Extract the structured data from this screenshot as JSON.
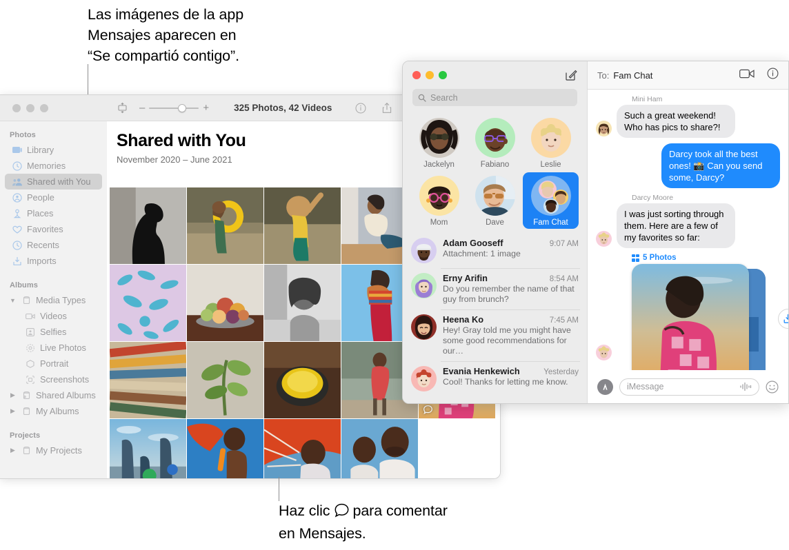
{
  "annotations": {
    "top": [
      "Las imágenes de la app",
      "Mensajes aparecen en",
      "“Se compartió contigo”."
    ],
    "bottom_before": "Haz clic",
    "bottom_after": "para comentar",
    "bottom_line2": "en Mensajes."
  },
  "photos": {
    "toolbar": {
      "import_icon": "import-icon",
      "zoom_minus": "–",
      "zoom_plus": "+",
      "count": "325 Photos, 42 Videos",
      "info_icon": "info-icon",
      "share_icon": "share-icon",
      "favorite_icon": "heart-icon",
      "rotate_icon": "rotate-icon"
    },
    "title": "Shared with You",
    "subtitle": "November 2020 – June 2021",
    "sidebar": {
      "sections": [
        {
          "header": "Photos",
          "items": [
            {
              "label": "Library",
              "icon": "library-icon",
              "selected": false
            },
            {
              "label": "Memories",
              "icon": "memories-icon",
              "selected": false
            },
            {
              "label": "Shared with You",
              "icon": "shared-with-you-icon",
              "selected": true
            },
            {
              "label": "People",
              "icon": "people-icon",
              "selected": false
            },
            {
              "label": "Places",
              "icon": "places-icon",
              "selected": false
            },
            {
              "label": "Favorites",
              "icon": "heart-icon",
              "selected": false
            },
            {
              "label": "Recents",
              "icon": "clock-icon",
              "selected": false
            },
            {
              "label": "Imports",
              "icon": "import-icon",
              "selected": false
            }
          ]
        },
        {
          "header": "Albums",
          "items": [
            {
              "label": "Media Types",
              "icon": "folder-icon",
              "disclosure": "open"
            },
            {
              "label": "Videos",
              "icon": "video-icon",
              "sub": true
            },
            {
              "label": "Selfies",
              "icon": "selfie-icon",
              "sub": true
            },
            {
              "label": "Live Photos",
              "icon": "live-photo-icon",
              "sub": true
            },
            {
              "label": "Portrait",
              "icon": "portrait-icon",
              "sub": true
            },
            {
              "label": "Screenshots",
              "icon": "screenshot-icon",
              "sub": true
            },
            {
              "label": "Shared Albums",
              "icon": "shared-folder-icon",
              "disclosure": "closed"
            },
            {
              "label": "My Albums",
              "icon": "folder-icon",
              "disclosure": "closed"
            }
          ]
        },
        {
          "header": "Projects",
          "items": [
            {
              "label": "My Projects",
              "icon": "folder-icon",
              "disclosure": "closed"
            }
          ]
        }
      ]
    },
    "grid": [
      {
        "name": "silhouette-bw-portrait",
        "comment": false
      },
      {
        "name": "child-yellow-float-river",
        "comment": false
      },
      {
        "name": "child-splashing-water",
        "comment": false
      },
      {
        "name": "man-seated-wall",
        "comment": false
      },
      {
        "name": "woman-doorway",
        "comment": false
      },
      {
        "name": "blue-floral-fabric",
        "comment": false
      },
      {
        "name": "fruit-bowl",
        "comment": false
      },
      {
        "name": "bw-portrait-curly-hair",
        "comment": false
      },
      {
        "name": "woman-red-pants-sky",
        "comment": false
      },
      {
        "name": "green-hillside",
        "comment": false
      },
      {
        "name": "colored-pencils",
        "comment": false
      },
      {
        "name": "green-plant-leaves",
        "comment": false
      },
      {
        "name": "yellow-bowl-fruit",
        "comment": false
      },
      {
        "name": "woman-walking-street",
        "comment": false
      },
      {
        "name": "field-landscape",
        "comment": false
      },
      {
        "name": "woman-pink-dress-sunset",
        "comment": true
      },
      {
        "name": "family-beach-sunset",
        "comment": true
      },
      {
        "name": "boy-popsicle-umbrella",
        "comment": true
      },
      {
        "name": "man-orange-umbrella",
        "comment": true
      },
      {
        "name": "father-and-son-portrait",
        "comment": true
      }
    ]
  },
  "messages": {
    "search_placeholder": "Search",
    "compose_icon": "compose-icon",
    "pinned": [
      {
        "label": "Jackelyn",
        "avatar": "photo-woman-sunglasses",
        "selected": false
      },
      {
        "label": "Fabiano",
        "avatar": "memoji-man-purple-glasses",
        "selected": false
      },
      {
        "label": "Leslie",
        "avatar": "memoji-blond-child",
        "selected": false
      },
      {
        "label": "Mom",
        "avatar": "memoji-woman-pink-glasses",
        "selected": false
      },
      {
        "label": "Dave",
        "avatar": "photo-man-sunglasses",
        "selected": false
      },
      {
        "label": "Fam Chat",
        "avatar": "group-avatar",
        "selected": true
      }
    ],
    "conversations": [
      {
        "name": "Adam Gooseff",
        "time": "9:07 AM",
        "preview": "Attachment: 1 image",
        "avatar": "memoji-man-white-cap"
      },
      {
        "name": "Erny Arifin",
        "time": "8:54 AM",
        "preview": "Do you remember the name of that guy from brunch?",
        "avatar": "memoji-woman-purple-hijab"
      },
      {
        "name": "Heena Ko",
        "time": "7:45 AM",
        "preview": "Hey! Gray told me you might have some good recommendations for our…",
        "avatar": "photo-woman-smiling"
      },
      {
        "name": "Evania Henkewich",
        "time": "Yesterday",
        "preview": "Cool! Thanks for letting me know.",
        "avatar": "memoji-red-hair"
      }
    ],
    "thread": {
      "to_label": "To:",
      "to_name": "Fam Chat",
      "facetime_icon": "facetime-video-icon",
      "details_icon": "info-icon",
      "bubbles": [
        {
          "sender": "Mini Ham",
          "text": "Such a great weekend! Who has pics to share?!",
          "direction": "in"
        },
        {
          "sender": "",
          "text": "Darcy took all the best ones! 📸 Can you send some, Darcy?",
          "direction": "out"
        },
        {
          "sender": "Darcy Moore",
          "text": "I was just sorting through them. Here are a few of my favorites so far:",
          "direction": "in"
        }
      ],
      "attachment_label": "5 Photos",
      "attachment_preview": "woman-pink-dress-sunset",
      "download_icon": "download-icon"
    },
    "composer": {
      "apps_icon": "app-store-icon",
      "placeholder": "iMessage",
      "audio_icon": "audio-waveform-icon",
      "emoji_icon": "emoji-smiley-icon"
    }
  },
  "colors": {
    "accent_blue": "#1f8bfd",
    "selected_pin": "#1d82f5",
    "bubble_gray": "#e9e9eb",
    "sidebar_gray": "#f2f2f2"
  }
}
